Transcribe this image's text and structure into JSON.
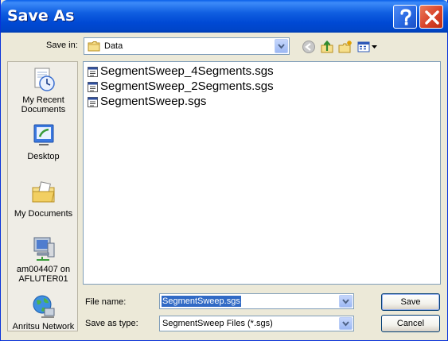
{
  "window": {
    "title": "Save As"
  },
  "titlebar_buttons": {
    "help": "?",
    "close": "×"
  },
  "toolbar": {
    "save_in_label": "Save in:",
    "save_in_value": "Data",
    "icons": [
      "back-icon",
      "up-folder-icon",
      "new-folder-icon",
      "view-menu-icon"
    ]
  },
  "places": [
    {
      "label": "My Recent\nDocuments",
      "icon": "recent-documents-icon"
    },
    {
      "label": "Desktop",
      "icon": "desktop-icon"
    },
    {
      "label": "My Documents",
      "icon": "my-documents-icon"
    },
    {
      "label": "am004407 on\nAFLUTER01",
      "icon": "computer-icon"
    },
    {
      "label": "Anritsu Network",
      "icon": "network-icon"
    }
  ],
  "files": [
    {
      "name": "SegmentSweep_4Segments.sgs"
    },
    {
      "name": "SegmentSweep_2Segments.sgs"
    },
    {
      "name": "SegmentSweep.sgs"
    }
  ],
  "form": {
    "file_name_label": "File name:",
    "file_name_value": "SegmentSweep.sgs",
    "save_as_type_label": "Save as type:",
    "save_as_type_value": "SegmentSweep Files (*.sgs)"
  },
  "buttons": {
    "save": "Save",
    "cancel": "Cancel"
  },
  "colors": {
    "title_bar": "#0054E3",
    "close_button": "#D9432A",
    "selection": "#316AC5",
    "dialog_bg": "#ECE9D8"
  }
}
